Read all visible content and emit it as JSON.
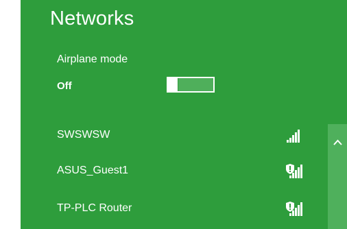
{
  "networks_panel": {
    "title": "Networks",
    "airplane_mode": {
      "label": "Airplane mode",
      "state_text": "Off",
      "enabled": false
    },
    "networks": [
      {
        "name": "SWSWSW",
        "secured": false,
        "signal_bars": 5
      },
      {
        "name": "ASUS_Guest1",
        "secured": true,
        "signal_bars": 5
      },
      {
        "name": "TP-PLC Router",
        "secured": true,
        "signal_bars": 5
      }
    ],
    "scrollbar": {
      "icon": "chevron-up-icon"
    },
    "colors": {
      "panel_bg": "#2e9d3c",
      "toggle_track": "#4faf5b",
      "scrollbar": "#4fb05c",
      "text": "#ffffff"
    }
  }
}
